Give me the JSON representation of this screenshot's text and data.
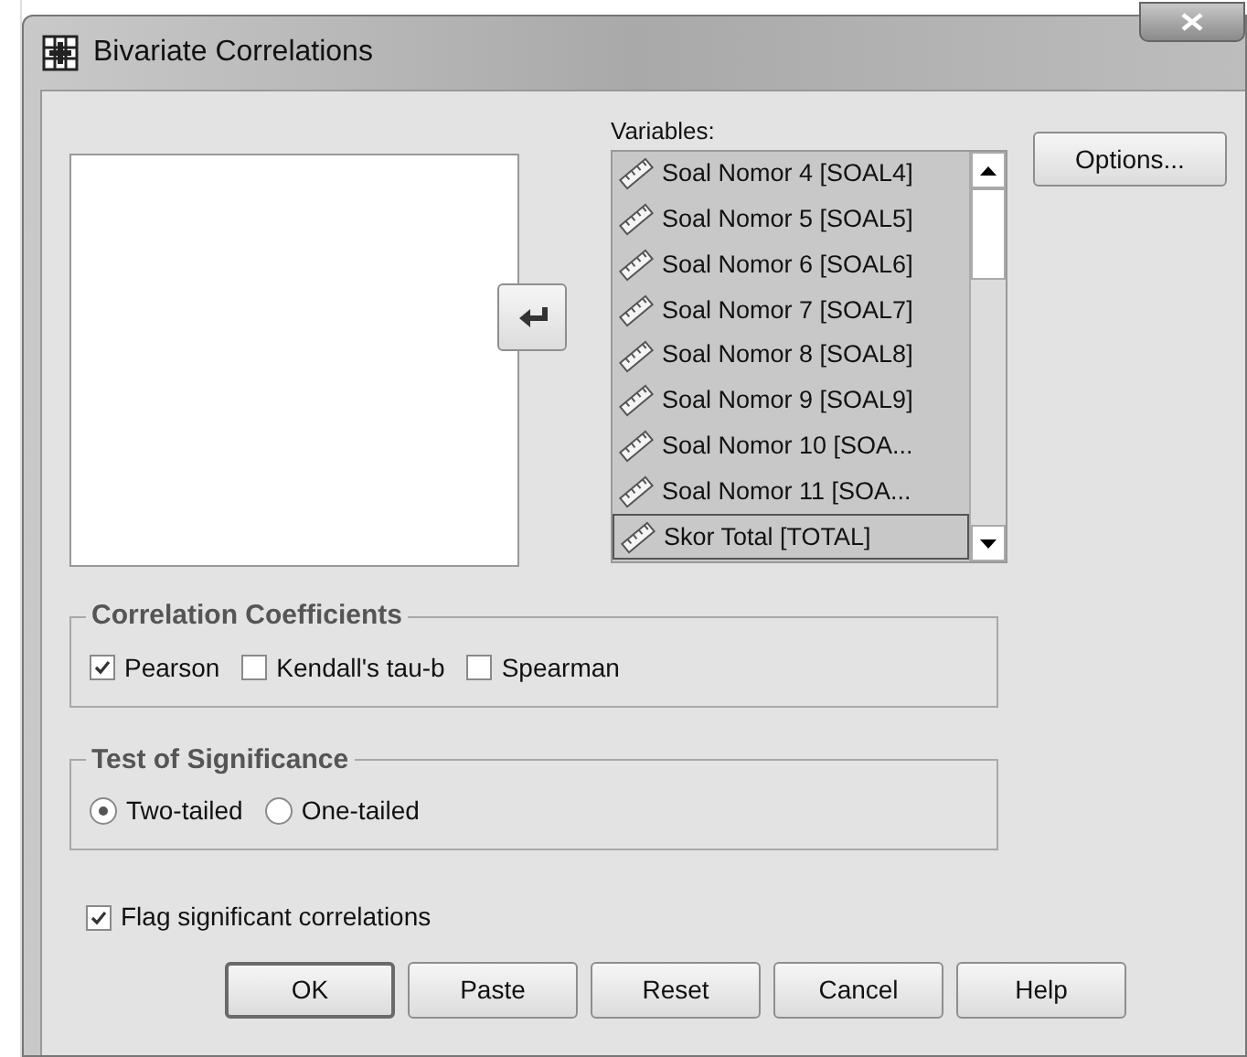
{
  "window": {
    "title": "Bivariate Correlations"
  },
  "variables": {
    "label": "Variables:",
    "items": [
      {
        "name": "Soal Nomor 4 [SOAL4]",
        "selected": true
      },
      {
        "name": "Soal Nomor 5 [SOAL5]",
        "selected": true
      },
      {
        "name": "Soal Nomor 6 [SOAL6]",
        "selected": true
      },
      {
        "name": "Soal Nomor 7 [SOAL7]",
        "selected": true
      },
      {
        "name": "Soal Nomor 8 [SOAL8]",
        "selected": true
      },
      {
        "name": "Soal Nomor 9 [SOAL9]",
        "selected": true
      },
      {
        "name": "Soal Nomor 10 [SOA...",
        "selected": true
      },
      {
        "name": "Soal Nomor 11 [SOA...",
        "selected": true
      },
      {
        "name": "Skor Total [TOTAL]",
        "selected": true
      }
    ]
  },
  "side_buttons": [
    "Options..."
  ],
  "correlation_coefficients": {
    "title": "Correlation Coefficients",
    "options": [
      {
        "label": "Pearson",
        "checked": true
      },
      {
        "label": "Kendall's tau-b",
        "checked": false
      },
      {
        "label": "Spearman",
        "checked": false
      }
    ]
  },
  "test_of_significance": {
    "title": "Test of Significance",
    "options": [
      {
        "label": "Two-tailed",
        "selected": true
      },
      {
        "label": "One-tailed",
        "selected": false
      }
    ]
  },
  "flag": {
    "label": "Flag significant correlations",
    "checked": true
  },
  "buttons": [
    {
      "label": "OK",
      "default": true
    },
    {
      "label": "Paste",
      "default": false
    },
    {
      "label": "Reset",
      "default": false
    },
    {
      "label": "Cancel",
      "default": false
    },
    {
      "label": "Help",
      "default": false
    }
  ]
}
